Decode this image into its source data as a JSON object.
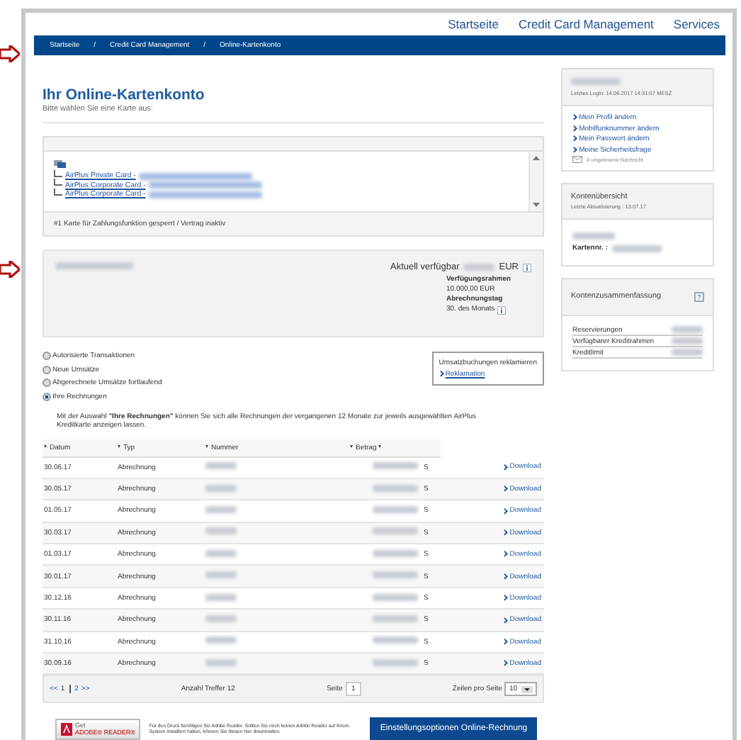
{
  "top_nav": [
    "Startseite",
    "Credit Card Management",
    "Services"
  ],
  "breadcrumb": [
    "Startseite",
    "/",
    "Credit Card Management",
    "/",
    "Online-Kartenkonto"
  ],
  "page": {
    "title": "Ihr Online-Kartenkonto",
    "subtitle": "Bitte wählen Sie eine Karte aus:"
  },
  "cards": {
    "items": [
      {
        "label": "AirPlus Private Card -"
      },
      {
        "label": "AirPlus Corporate Card -"
      },
      {
        "label": "AirPlus Corporate Card -"
      }
    ],
    "note": "#1 Karte für Zahlungsfunktion gesperrt / Vertrag inaktiv"
  },
  "account": {
    "available_label": "Aktuell verfügbar",
    "currency": "EUR",
    "limit_label": "Verfügungsrahmen",
    "limit_value": "10.000,00 EUR",
    "billing_label": "Abrechnungstag",
    "billing_value": "30. des Monats"
  },
  "views": [
    {
      "label": "Autorisierte Transaktionen",
      "selected": false
    },
    {
      "label": "Neue Umsätze",
      "selected": false
    },
    {
      "label": "Abgerechnete Umsätze fortlaufend",
      "selected": false
    },
    {
      "label": "Ihre Rechnungen",
      "selected": true
    }
  ],
  "reclamation": {
    "title": "Umsatzbuchungen reklamieren",
    "link": "Reklamation"
  },
  "description": "Mit der Auswahl **\"Ihre Rechnungen\"** können Sie sich alle Rechnungen der vergangenen 12 Monate zur jeweils ausgewählten AirPlus Kreditkarte anzeigen lassen.",
  "table": {
    "columns": [
      "Datum",
      "Typ",
      "Nummer",
      "Betrag"
    ],
    "rows": [
      {
        "date": "30.06.17",
        "type": "Abrechnung",
        "currency": "S",
        "action": "Download"
      },
      {
        "date": "30.05.17",
        "type": "Abrechnung",
        "currency": "S",
        "action": "Download"
      },
      {
        "date": "01.05.17",
        "type": "Abrechnung",
        "currency": "S",
        "action": "Download"
      },
      {
        "date": "30.03.17",
        "type": "Abrechnung",
        "currency": "S",
        "action": "Download"
      },
      {
        "date": "01.03.17",
        "type": "Abrechnung",
        "currency": "S",
        "action": "Download"
      },
      {
        "date": "30.01.17",
        "type": "Abrechnung",
        "currency": "S",
        "action": "Download"
      },
      {
        "date": "30.12.16",
        "type": "Abrechnung",
        "currency": "S",
        "action": "Download"
      },
      {
        "date": "30.11.16",
        "type": "Abrechnung",
        "currency": "S",
        "action": "Download"
      },
      {
        "date": "31.10.16",
        "type": "Abrechnung",
        "currency": "S",
        "action": "Download"
      },
      {
        "date": "30.09.16",
        "type": "Abrechnung",
        "currency": "S",
        "action": "Download"
      }
    ]
  },
  "pagination": {
    "prev": "<<",
    "pages": [
      {
        "label": "1",
        "selected": true
      },
      {
        "label": "2",
        "selected": false
      }
    ],
    "next": ">>",
    "hits": "Anzahl Treffer 12",
    "page_label": "Seite",
    "page_value": "1",
    "rows_label": "Zeilen pro Seite",
    "rows_value": "10"
  },
  "footer": {
    "adobe_badge": [
      "Get",
      "ADOBE® READER®"
    ],
    "adobe_text": "Für den Druck benötigen Sie Adobe Reader. Sollten Sie noch keinen Adobe Reader auf Ihrem System installiert haben, können Sie diesen hier downloaden.",
    "button": "Einstellungsoptionen Online-Rechnung"
  },
  "sidebar": {
    "login": "Letztes Login: 14.06.2017 14:31:07 MESZ",
    "links": [
      "Mein Profil ändern",
      "Mobilfunknummer ändern",
      "Mein Passwort ändern",
      "Meine Sicherheitsfrage"
    ],
    "messages": "0 ungelesene Nachricht",
    "overview_title": "Kontenübersicht",
    "overview_update": "Letzte Aktualisierung :  13.07.17",
    "card_no_label": "Kartennr. :",
    "summary_title": "Kontenzusammenfassung",
    "summary_help": "?",
    "summary_rows": [
      "Reservierungen",
      "Verfügbarer Kreditrahmen",
      "Kreditlimit"
    ]
  }
}
